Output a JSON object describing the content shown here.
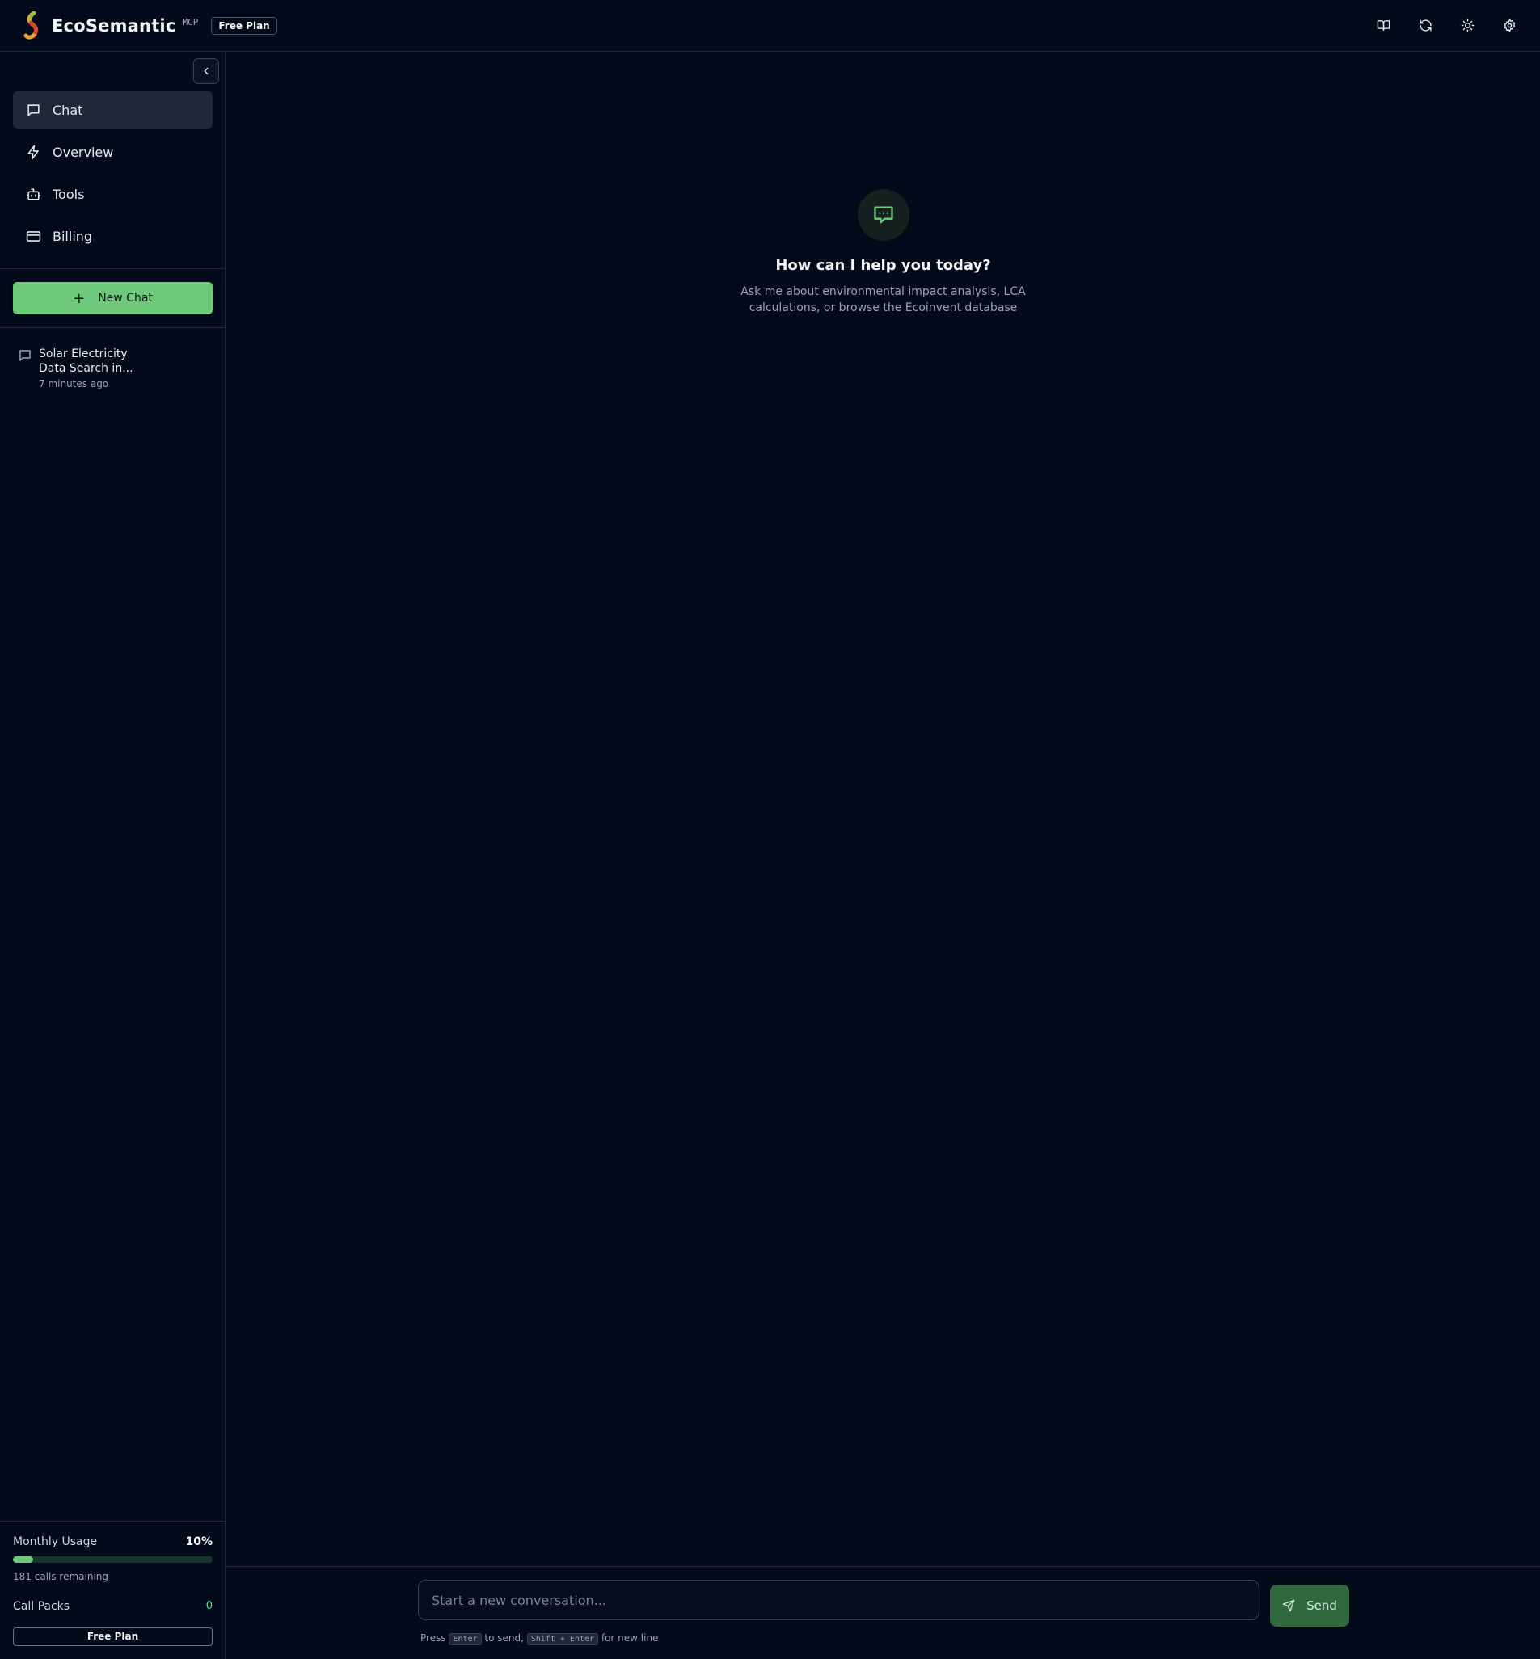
{
  "header": {
    "brand": "EcoSemantic",
    "tag": "MCP",
    "plan": "Free Plan",
    "actions": [
      "book-open-icon",
      "refresh-icon",
      "sun-icon",
      "settings-icon"
    ]
  },
  "sidebar": {
    "nav": [
      {
        "label": "Chat",
        "icon": "message-square-icon",
        "active": true
      },
      {
        "label": "Overview",
        "icon": "zap-icon"
      },
      {
        "label": "Tools",
        "icon": "bot-icon"
      },
      {
        "label": "Billing",
        "icon": "credit-card-icon"
      }
    ],
    "new_chat_label": "New Chat",
    "history": [
      {
        "title": "Solar Electricity Data Search in...",
        "time": "7 minutes ago"
      }
    ],
    "usage": {
      "label": "Monthly Usage",
      "percent_text": "10%",
      "percent": 10,
      "remaining": "181 calls remaining",
      "packs_label": "Call Packs",
      "packs_count": "0",
      "plan": "Free Plan"
    }
  },
  "main": {
    "welcome_title": "How can I help you today?",
    "welcome_sub": "Ask me about environmental impact analysis, LCA calculations, or browse the Ecoinvent database",
    "input_placeholder": "Start a new conversation...",
    "send_label": "Send",
    "hint": {
      "press": "Press",
      "enter": "Enter",
      "to_send": "to send,",
      "shift_enter": "Shift + Enter",
      "for_new_line": "for new line"
    }
  },
  "colors": {
    "accent": "#6fc97a",
    "background": "#030a1a",
    "send": "#2f6a3f"
  }
}
